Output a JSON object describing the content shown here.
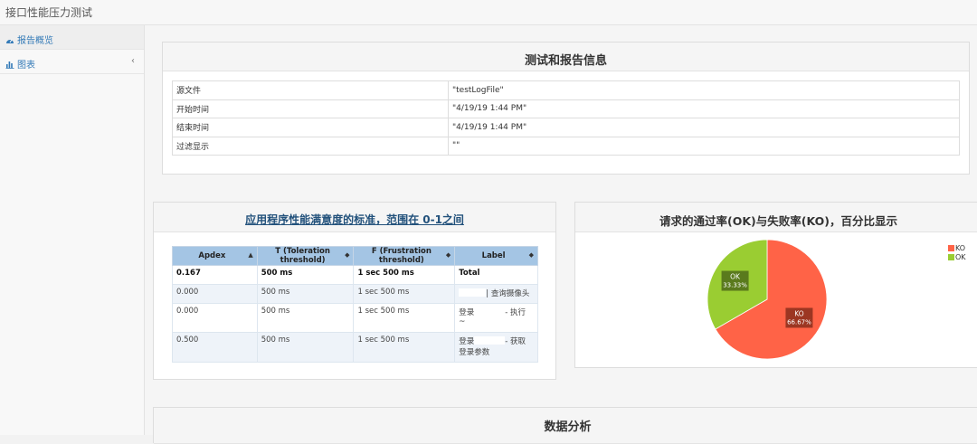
{
  "app": {
    "title": "接口性能压力测试"
  },
  "sidebar": {
    "items": [
      {
        "label": "报告概览"
      },
      {
        "label": "图表",
        "chevron": "‹"
      }
    ]
  },
  "info_panel": {
    "title": "测试和报告信息",
    "rows": [
      {
        "key": "源文件",
        "value": "\"testLogFile\""
      },
      {
        "key": "开始时间",
        "value": "\"4/19/19 1:44 PM\""
      },
      {
        "key": "结束时间",
        "value": "\"4/19/19 1:44 PM\""
      },
      {
        "key": "过滤显示",
        "value": "\"\""
      }
    ]
  },
  "apdex_panel": {
    "title": "应用程序性能满意度的标准，范围在 0-1之间",
    "columns": [
      "Apdex",
      "T (Toleration threshold)",
      "F (Frustration threshold)",
      "Label"
    ],
    "sort_asc": "▲",
    "sort_both": "◆",
    "rows": [
      [
        "0.167",
        "500 ms",
        "1 sec 500 ms",
        "Total"
      ],
      [
        "0.000",
        "500 ms",
        "1 sec 500 ms",
        "| 查询摄像头"
      ],
      [
        "0.000",
        "500 ms",
        "1 sec 500 ms",
        "登录",
        "- 执行",
        "~"
      ],
      [
        "0.500",
        "500 ms",
        "1 sec 500 ms",
        "登录",
        "- 获取",
        "登录参数"
      ]
    ]
  },
  "pie_panel": {
    "title": "请求的通过率(OK)与失败率(KO)，百分比显示"
  },
  "chart_data": {
    "type": "pie",
    "title": "请求的通过率(OK)与失败率(KO)，百分比显示",
    "slices": [
      {
        "name": "KO",
        "value": 66.67,
        "label": "66.67%",
        "color": "#ff6347"
      },
      {
        "name": "OK",
        "value": 33.33,
        "label": "33.33%",
        "color": "#9acd32"
      }
    ],
    "legend": [
      "KO",
      "OK"
    ],
    "legend_position": "top-right"
  },
  "analysis_panel": {
    "title": "数据分析"
  },
  "colors": {
    "link": "#337ab7",
    "header_blue": "#a4c5e4",
    "ko": "#ff6347",
    "ok": "#9acd32"
  }
}
